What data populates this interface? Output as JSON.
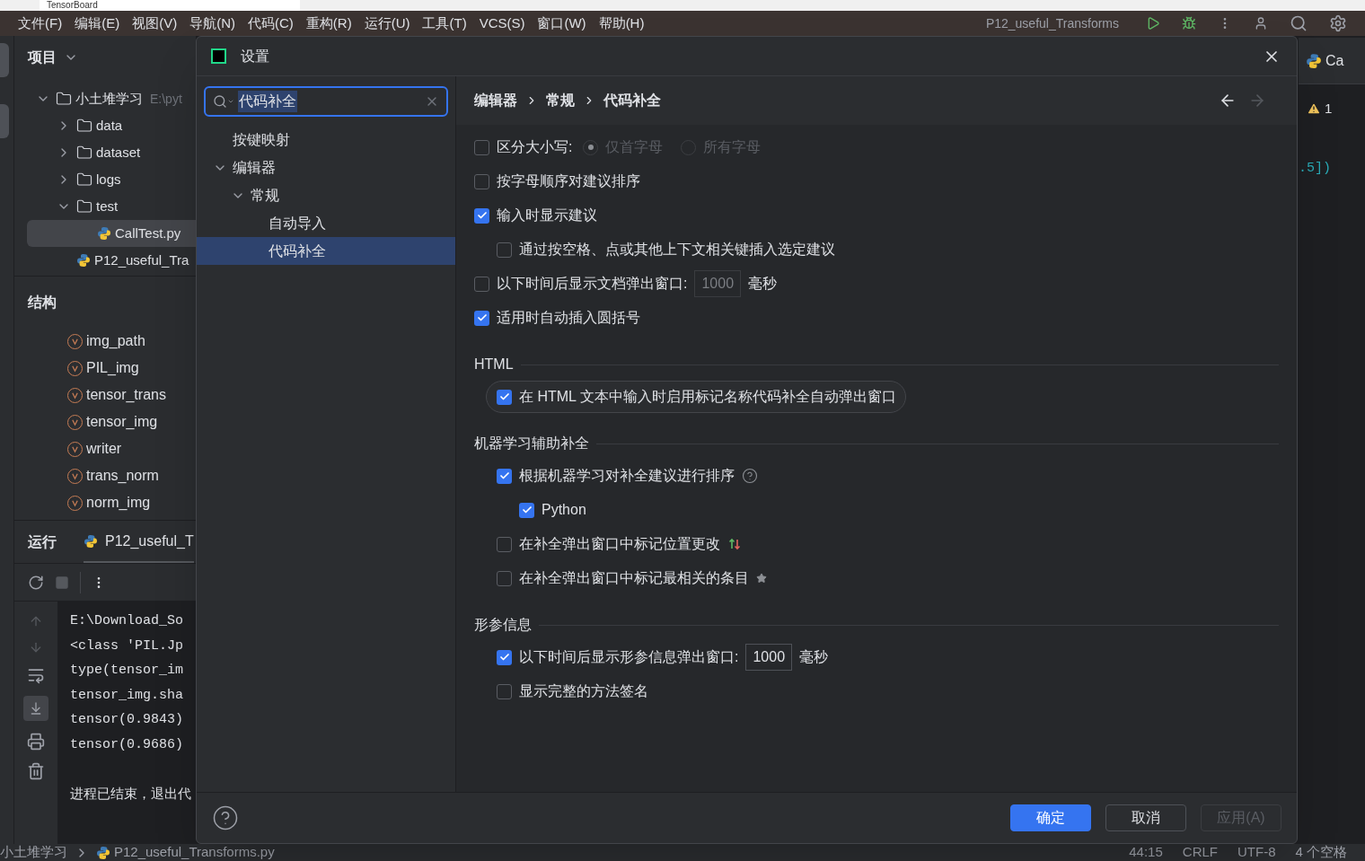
{
  "ide": {
    "tab": "TensorBoard",
    "menu": [
      "文件(F)",
      "编辑(E)",
      "视图(V)",
      "导航(N)",
      "代码(C)",
      "重构(R)",
      "运行(U)",
      "工具(T)",
      "VCS(S)",
      "窗口(W)",
      "帮助(H)"
    ],
    "run_config": "P12_useful_Transforms",
    "project": {
      "title": "项目",
      "tree": [
        {
          "label": "小土堆学习",
          "path": "E:\\pyt",
          "kind": "folder",
          "expanded": true,
          "selected": false,
          "children": [
            {
              "label": "data",
              "kind": "folder",
              "expanded": false,
              "selected": false
            },
            {
              "label": "dataset",
              "kind": "folder",
              "expanded": false,
              "selected": false
            },
            {
              "label": "logs",
              "kind": "folder",
              "expanded": false,
              "selected": false
            },
            {
              "label": "test",
              "kind": "folder",
              "expanded": true,
              "selected": false,
              "children": [
                {
                  "label": "CallTest.py",
                  "kind": "python",
                  "selected": true
                }
              ]
            },
            {
              "label": "P12_useful_Tra",
              "kind": "python",
              "selected": false
            }
          ]
        }
      ]
    },
    "structure": {
      "title": "结构",
      "items": [
        "img_path",
        "PIL_img",
        "tensor_trans",
        "tensor_img",
        "writer",
        "trans_norm",
        "norm_img"
      ]
    },
    "run": {
      "title": "运行",
      "tab": "P12_useful_T",
      "console": [
        "E:\\Download_So",
        "<class 'PIL.Jp",
        "type(tensor_im",
        "tensor_img.sha",
        "tensor(0.9843)",
        "tensor(0.9686)"
      ],
      "exit_message": "进程已结束，退出代"
    },
    "editor": {
      "tab": "Ca",
      "warnings": "1",
      "code": ".5])"
    },
    "status": {
      "breadcrumb": [
        "小土堆学习",
        "P12_useful_Transforms.py"
      ],
      "position": "44:15",
      "line_ending": "CRLF",
      "encoding": "UTF-8",
      "indent": "4 个空格"
    }
  },
  "dialog": {
    "title": "设置",
    "search": {
      "value": "代码补全"
    },
    "nav": [
      {
        "label": "按键映射",
        "selected": false
      },
      {
        "label": "编辑器",
        "selected": false,
        "expanded": true,
        "children": [
          {
            "label": "常规",
            "selected": false,
            "expanded": true,
            "children": [
              {
                "label": "自动导入",
                "selected": false
              },
              {
                "label": "代码补全",
                "selected": true
              }
            ]
          }
        ]
      }
    ],
    "breadcrumb": [
      "编辑器",
      "常规",
      "代码补全"
    ],
    "sections": [
      {
        "items": [
          {
            "kind": "case",
            "label": "区分大小写:",
            "checked": false,
            "options": [
              {
                "label": "仅首字母",
                "selected": true
              },
              {
                "label": "所有字母",
                "selected": false
              }
            ]
          },
          {
            "kind": "checkbox",
            "label": "按字母顺序对建议排序",
            "checked": false
          },
          {
            "kind": "checkbox",
            "label": "输入时显示建议",
            "checked": true,
            "children": [
              {
                "kind": "checkbox",
                "label": "通过按空格、点或其他上下文相关键插入选定建议",
                "checked": false
              }
            ]
          },
          {
            "kind": "delay",
            "label": "以下时间后显示文档弹出窗口:",
            "checked": false,
            "value": "1000",
            "unit": "毫秒"
          },
          {
            "kind": "checkbox",
            "label": "适用时自动插入圆括号",
            "checked": true
          }
        ]
      },
      {
        "title": "HTML",
        "items": [
          {
            "kind": "checkbox",
            "label": "在 HTML 文本中输入时启用标记名称代码补全自动弹出窗口",
            "checked": true,
            "highlighted": true
          }
        ]
      },
      {
        "title": "机器学习辅助补全",
        "items": [
          {
            "kind": "checkbox_help",
            "label": "根据机器学习对补全建议进行排序",
            "checked": true,
            "children": [
              {
                "kind": "checkbox",
                "label": "Python",
                "checked": true
              }
            ]
          },
          {
            "kind": "checkbox_moved",
            "label": "在补全弹出窗口中标记位置更改",
            "checked": false
          },
          {
            "kind": "checkbox_starred",
            "label": "在补全弹出窗口中标记最相关的条目",
            "checked": false
          }
        ]
      },
      {
        "title": "形参信息",
        "items": [
          {
            "kind": "delay",
            "label": "以下时间后显示形参信息弹出窗口:",
            "checked": true,
            "value": "1000",
            "unit": "毫秒"
          },
          {
            "kind": "checkbox",
            "label": "显示完整的方法签名",
            "checked": false
          }
        ]
      }
    ],
    "buttons": [
      {
        "label": "确定",
        "kind": "primary"
      },
      {
        "label": "取消",
        "kind": "normal"
      },
      {
        "label": "应用(A)",
        "kind": "disabled"
      }
    ]
  }
}
